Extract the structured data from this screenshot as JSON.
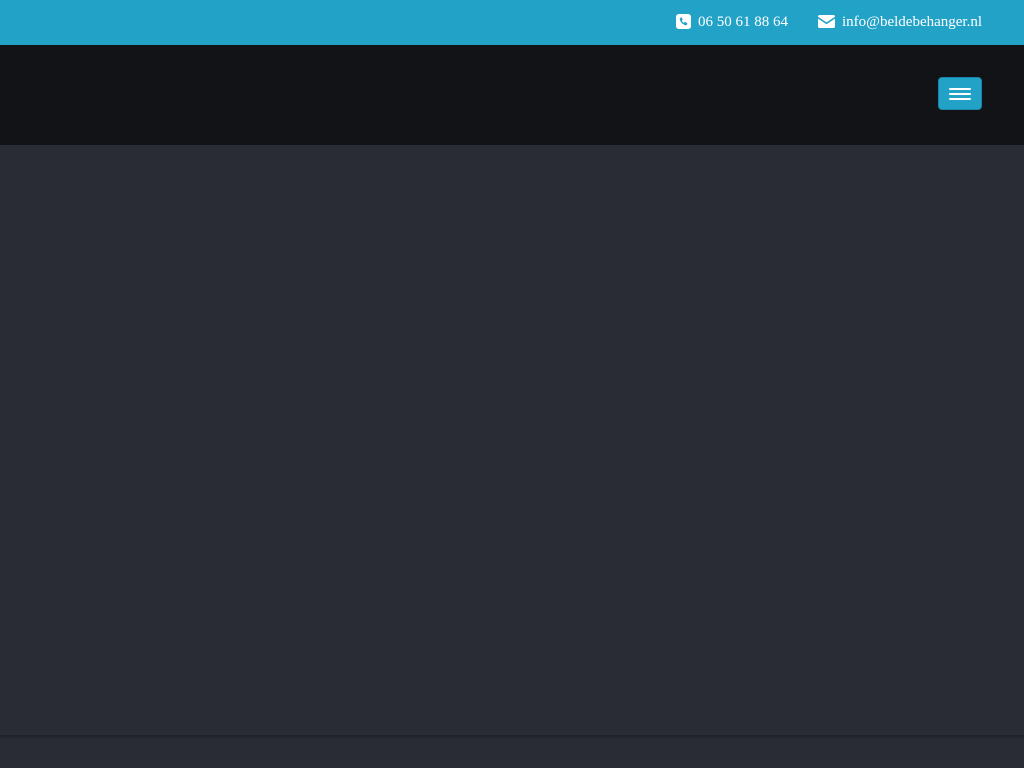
{
  "topbar": {
    "phone": {
      "icon": "phone-square-icon",
      "label": "06 50 61 88 64"
    },
    "email": {
      "icon": "envelope-icon",
      "label": "info@beldebehanger.nl"
    }
  },
  "navbar": {
    "menu_toggle": {
      "icon": "hamburger-menu-icon"
    }
  },
  "colors": {
    "accent": "#22a2c7",
    "navbar_bg": "#121316",
    "page_bg": "#292c35",
    "text_light": "#ffffff"
  }
}
